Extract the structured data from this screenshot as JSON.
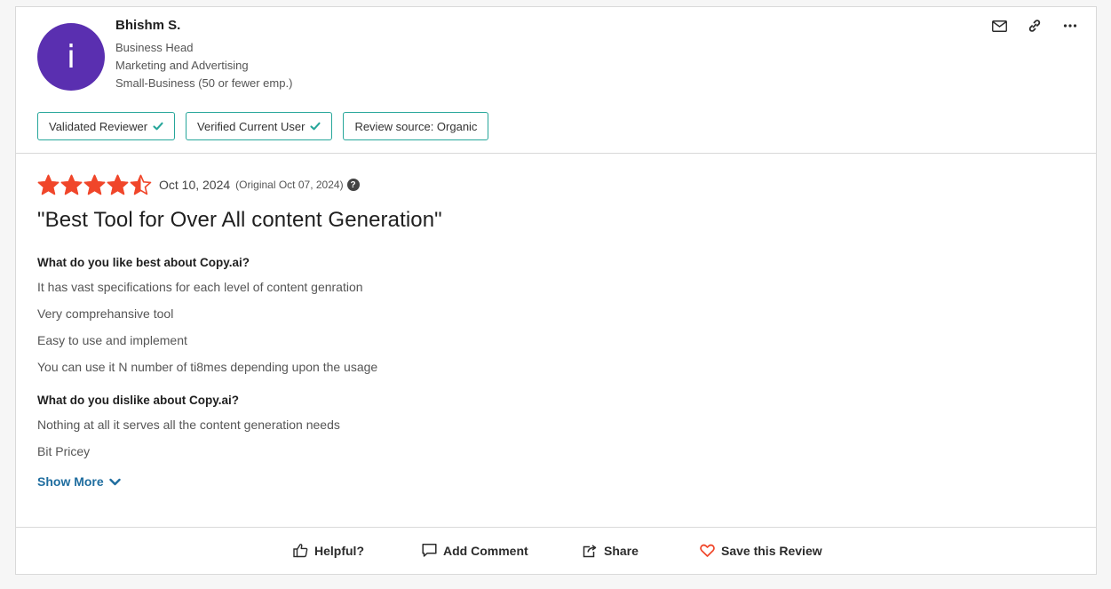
{
  "reviewer": {
    "avatar_letter": "i",
    "name": "Bhishm S.",
    "title": "Business Head",
    "industry": "Marketing and Advertising",
    "company_size": "Small-Business (50 or fewer emp.)",
    "avatar_color": "#5a2fb0"
  },
  "actions": {
    "icons": [
      "mail-icon",
      "link-icon",
      "more-icon"
    ]
  },
  "badges": [
    {
      "label": "Validated Reviewer",
      "checked": true
    },
    {
      "label": "Verified Current User",
      "checked": true
    },
    {
      "label": "Review source: Organic",
      "checked": false
    }
  ],
  "review": {
    "rating": 4.5,
    "date": "Oct 10, 2024",
    "original_date": "(Original Oct 07, 2024)",
    "title": "\"Best Tool for Over All content Generation\"",
    "like_question": "What do you like best about Copy.ai?",
    "like_answers": [
      "It has vast specifications for each level of content genration",
      "Very comprehansive tool",
      "Easy to use and implement",
      "You can use it N number of ti8mes depending upon the usage"
    ],
    "dislike_question": "What do you dislike about Copy.ai?",
    "dislike_answers": [
      "Nothing at all it serves all the content generation needs",
      "Bit Pricey"
    ],
    "show_more": "Show More"
  },
  "footer": {
    "helpful": "Helpful?",
    "add_comment": "Add Comment",
    "share": "Share",
    "save": "Save this Review"
  },
  "colors": {
    "star": "#f0462a",
    "badge_border": "#26a69a",
    "check": "#26a69a",
    "link": "#1f6d9f",
    "heart": "#f0462a"
  }
}
